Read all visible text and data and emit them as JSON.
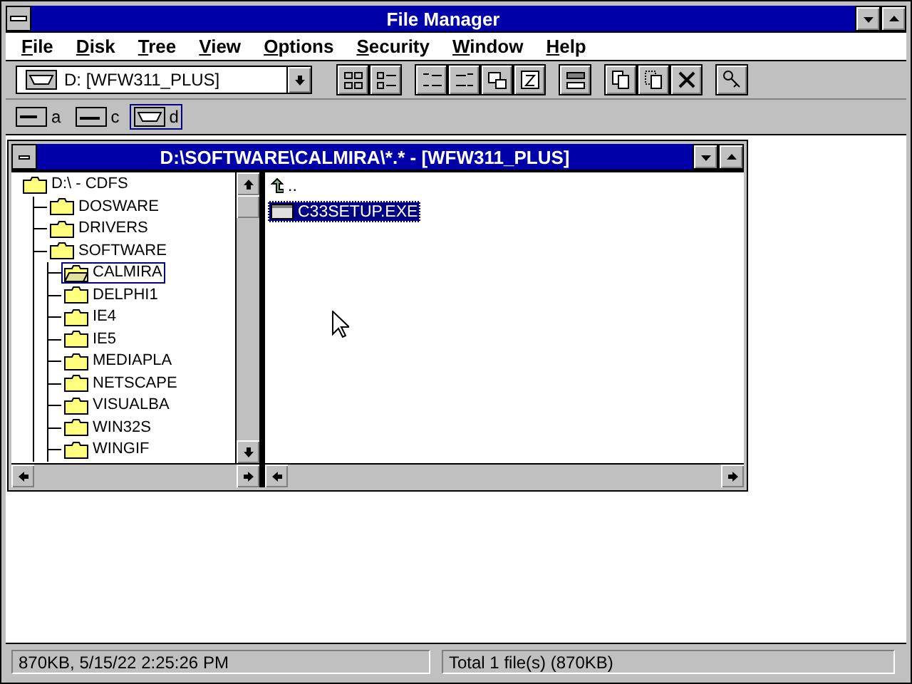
{
  "window": {
    "title": "File Manager"
  },
  "menu": [
    "File",
    "Disk",
    "Tree",
    "View",
    "Options",
    "Security",
    "Window",
    "Help"
  ],
  "drive_select": {
    "value": "D: [WFW311_PLUS]"
  },
  "drives": [
    {
      "kind": "floppy",
      "letter": "a",
      "selected": false
    },
    {
      "kind": "hard",
      "letter": "c",
      "selected": false
    },
    {
      "kind": "cdrom",
      "letter": "d",
      "selected": true
    }
  ],
  "child_window": {
    "title": "D:\\SOFTWARE\\CALMIRA\\*.* - [WFW311_PLUS]",
    "tree": [
      {
        "label": "D:\\ - CDFS",
        "selected": false,
        "children": [
          {
            "label": "DOSWARE",
            "selected": false
          },
          {
            "label": "DRIVERS",
            "selected": false
          },
          {
            "label": "SOFTWARE",
            "selected": false,
            "children": [
              {
                "label": "CALMIRA",
                "selected": true
              },
              {
                "label": "DELPHI1",
                "selected": false
              },
              {
                "label": "IE4",
                "selected": false
              },
              {
                "label": "IE5",
                "selected": false
              },
              {
                "label": "MEDIAPLA",
                "selected": false
              },
              {
                "label": "NETSCAPE",
                "selected": false
              },
              {
                "label": "VISUALBA",
                "selected": false
              },
              {
                "label": "WIN32S",
                "selected": false
              },
              {
                "label": "WINGIF",
                "selected": false
              }
            ]
          }
        ]
      }
    ],
    "files": [
      {
        "kind": "parent",
        "name": "..",
        "selected": false
      },
      {
        "kind": "program",
        "name": "C33SETUP.EXE",
        "selected": true
      }
    ]
  },
  "status_bar": [
    "870KB, 5/15/22 2:25:26 PM",
    "Total 1 file(s) (870KB)"
  ]
}
